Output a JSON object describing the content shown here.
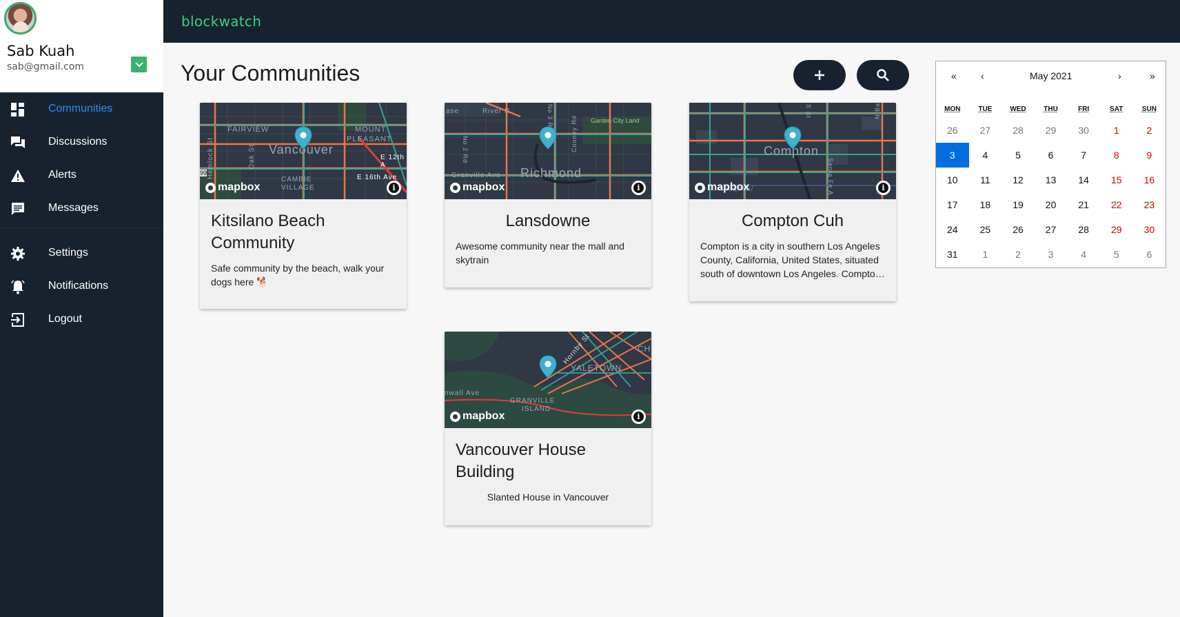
{
  "app": {
    "brand": "blockwatch"
  },
  "profile": {
    "name": "Sab Kuah",
    "email": "sab@gmail.com"
  },
  "nav": {
    "items": [
      {
        "label": "Communities",
        "icon": "dashboard-icon",
        "active": true
      },
      {
        "label": "Discussions",
        "icon": "forum-icon"
      },
      {
        "label": "Alerts",
        "icon": "warning-icon"
      },
      {
        "label": "Messages",
        "icon": "message-icon"
      }
    ],
    "secondary": [
      {
        "label": "Settings",
        "icon": "gear-icon"
      },
      {
        "label": "Notifications",
        "icon": "bell-icon"
      },
      {
        "label": "Logout",
        "icon": "logout-icon"
      }
    ]
  },
  "page": {
    "title": "Your Communities"
  },
  "communities": [
    {
      "title": "Kitsilano Beach Community",
      "description": "Safe community by the beach, walk your dogs here 🐕",
      "map": {
        "place": "Vancouver",
        "labels": [
          "FAIRVIEW",
          "MOUNT",
          "PLEASANT",
          "CAMBIE",
          "VILLAGE",
          "E 16th Ave",
          "E 12th A",
          "Hemlock St",
          "Oak St",
          "99"
        ]
      }
    },
    {
      "title": "Lansdowne",
      "description": "Awesome community near the mall and skytrain",
      "map": {
        "place": "Richmond",
        "labels": [
          "ase",
          "River R",
          "No 3 Rd",
          "Cooney Rd",
          "Garden City Land",
          "No 2 Rd",
          "Granville Ave"
        ]
      }
    },
    {
      "title": "Compton Cuh",
      "description": "Compton is a city in southern Los Angeles County, California, United States, situated south of downtown Los Angeles. Compton is one of the oldest cities in the county.",
      "map": {
        "place": "Compton",
        "labels": [
          "Compton/",
          "Santa Fe A",
          "N Ba",
          "S St"
        ]
      }
    },
    {
      "title": "Vancouver House Building",
      "description": "Slanted House in Vancouver",
      "map": {
        "place": "",
        "labels": [
          "YALETOWN",
          "GRANVILLE",
          "ISLAND",
          "Hornby St",
          "nwall Ave",
          "CH"
        ]
      }
    }
  ],
  "mapbox": {
    "attribution": "mapbox",
    "info": "i"
  },
  "calendar": {
    "month_label": "May 2021",
    "nav": {
      "prev_year": "«",
      "prev_month": "‹",
      "next_month": "›",
      "next_year": "»"
    },
    "weekdays": [
      "MON",
      "TUE",
      "WED",
      "THU",
      "FRI",
      "SAT",
      "SUN"
    ],
    "days": [
      [
        "26",
        "27",
        "28",
        "29",
        "30",
        "1",
        "2"
      ],
      [
        "3",
        "4",
        "5",
        "6",
        "7",
        "8",
        "9"
      ],
      [
        "10",
        "11",
        "12",
        "13",
        "14",
        "15",
        "16"
      ],
      [
        "17",
        "18",
        "19",
        "20",
        "21",
        "22",
        "23"
      ],
      [
        "24",
        "25",
        "26",
        "27",
        "28",
        "29",
        "30"
      ],
      [
        "31",
        "1",
        "2",
        "3",
        "4",
        "5",
        "6"
      ]
    ],
    "selected": "3"
  },
  "colors": {
    "sidebar": "#16232e",
    "brand": "#3ccf84",
    "active": "#2a8cf0",
    "today": "#006edc",
    "weekend": "#d10000"
  }
}
